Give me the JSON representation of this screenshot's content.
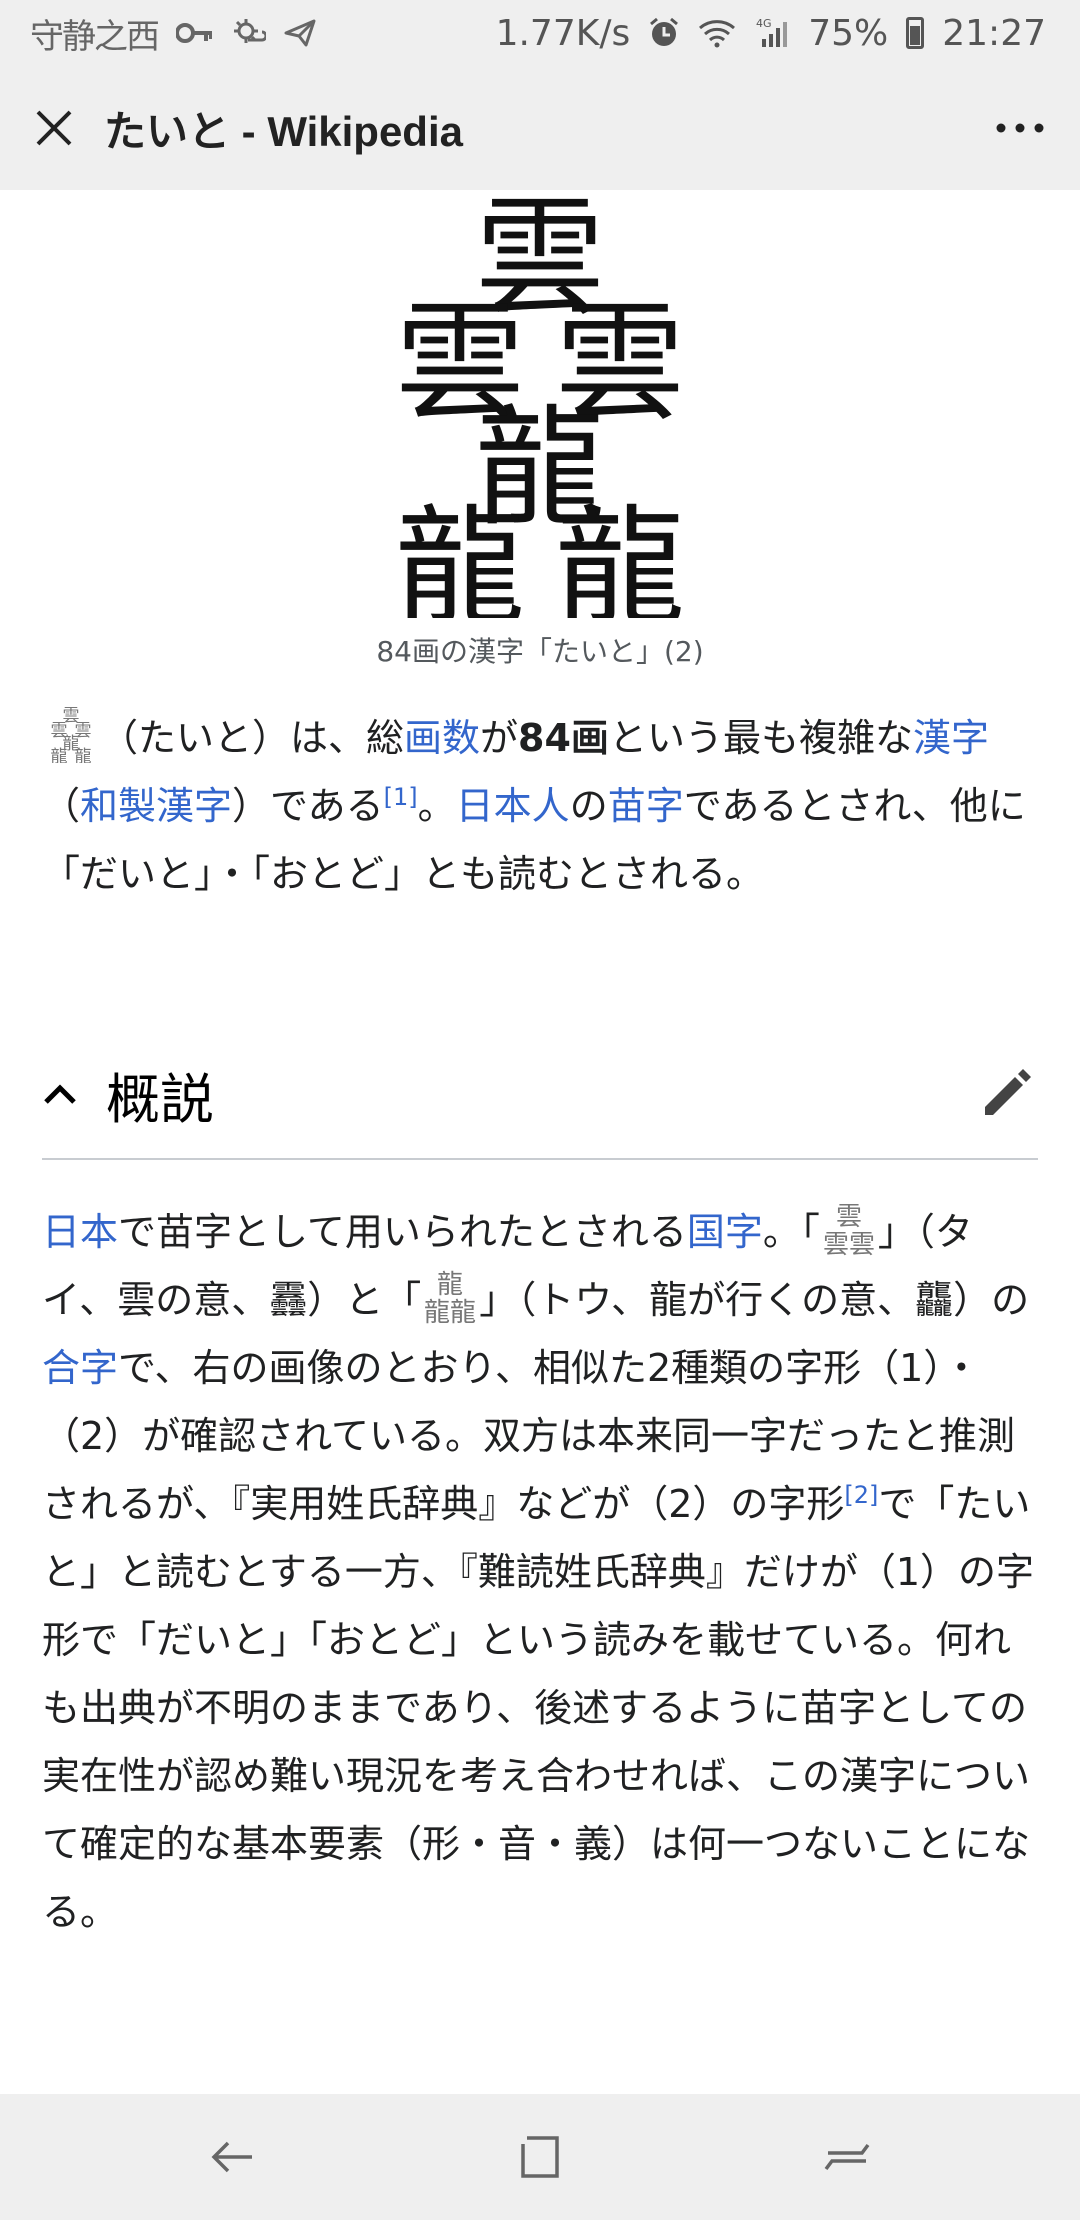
{
  "status_bar": {
    "brand": "守静之西",
    "network_speed": "1.77K/s",
    "network_type": "4G",
    "battery": "75%",
    "time": "21:27"
  },
  "app_bar": {
    "title": "たいと - Wikipedia"
  },
  "figure": {
    "caption": "84画の漢字「たいと」(2)"
  },
  "intro": {
    "t1": "（たいと）は、総",
    "l_stroke": "画数",
    "t2": "が",
    "bold": "84画",
    "t3": "という最も複雑な",
    "l_kanji": "漢字",
    "t4": "（",
    "l_wasei": "和製漢字",
    "t5": "）である",
    "ref1": "[1]",
    "t6": "。",
    "l_japanese": "日本人",
    "t7": "の",
    "l_surname": "苗字",
    "t8": "であるとされ、他に「だいと」・「おとど」とも読むとされる。"
  },
  "section": {
    "title": "概説"
  },
  "overview": {
    "l_japan": "日本",
    "t1": "で苗字として用いられたとされる",
    "l_kokuji": "国字",
    "t2": "。「",
    "t3": "」（タイ、雲の意、䨺）と「",
    "t4": "」（トウ、龍が行くの意、龘）の",
    "l_ligature": "合字",
    "t5": "で、右の画像のとおり、相似た2種類の字形（1）・（2）が確認されている。双方は本来同一字だったと推測されるが、『実用姓氏辞典』などが（2）の字形",
    "ref2": "[2]",
    "t6": "で「たいと」と読むとする一方、『難読姓氏辞典』だけが（1）の字形で「だいと」「おとど」という読みを載せている。何れも出典が不明のままであり、後述するように苗字としての実在性が認め難い現況を考え合わせれば、この漢字について確定的な基本要素（形・音・義）は何一つないことになる。"
  },
  "icons": {
    "close": "close-icon",
    "more": "more-vert-icon",
    "collapse": "chevron-up-icon",
    "edit": "pencil-icon",
    "back": "back-icon",
    "home": "home-square-icon",
    "recents": "recents-icon"
  },
  "colors": {
    "link": "#3366cc",
    "chrome_bg": "#efefef",
    "text": "#202122"
  }
}
